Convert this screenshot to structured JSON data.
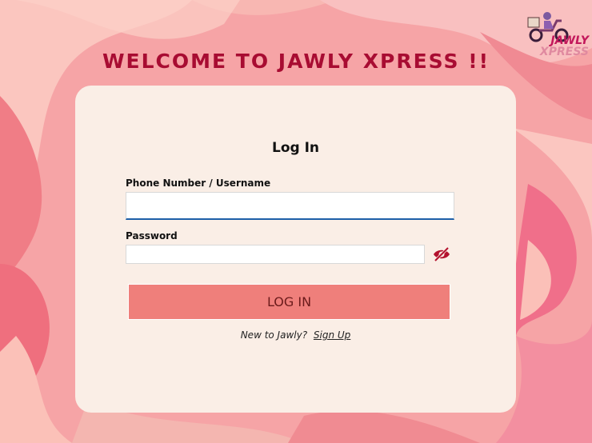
{
  "header": {
    "title": "WELCOME TO JAWLY XPRESS !!"
  },
  "logo": {
    "text_top": "JAWLY",
    "text_bottom": "XPRESS"
  },
  "login": {
    "heading": "Log In",
    "username_label": "Phone Number / Username",
    "username_value": "",
    "password_label": "Password",
    "password_value": "",
    "button_label": "LOG IN",
    "signup_prompt": "New to Jawly?",
    "signup_link": "Sign Up"
  },
  "colors": {
    "background": "#f6a4a6",
    "title": "#a80c32",
    "card": "#faeee6",
    "button": "#ef7f7b",
    "eye_icon": "#b3122e",
    "focus": "#1e5fa8"
  }
}
